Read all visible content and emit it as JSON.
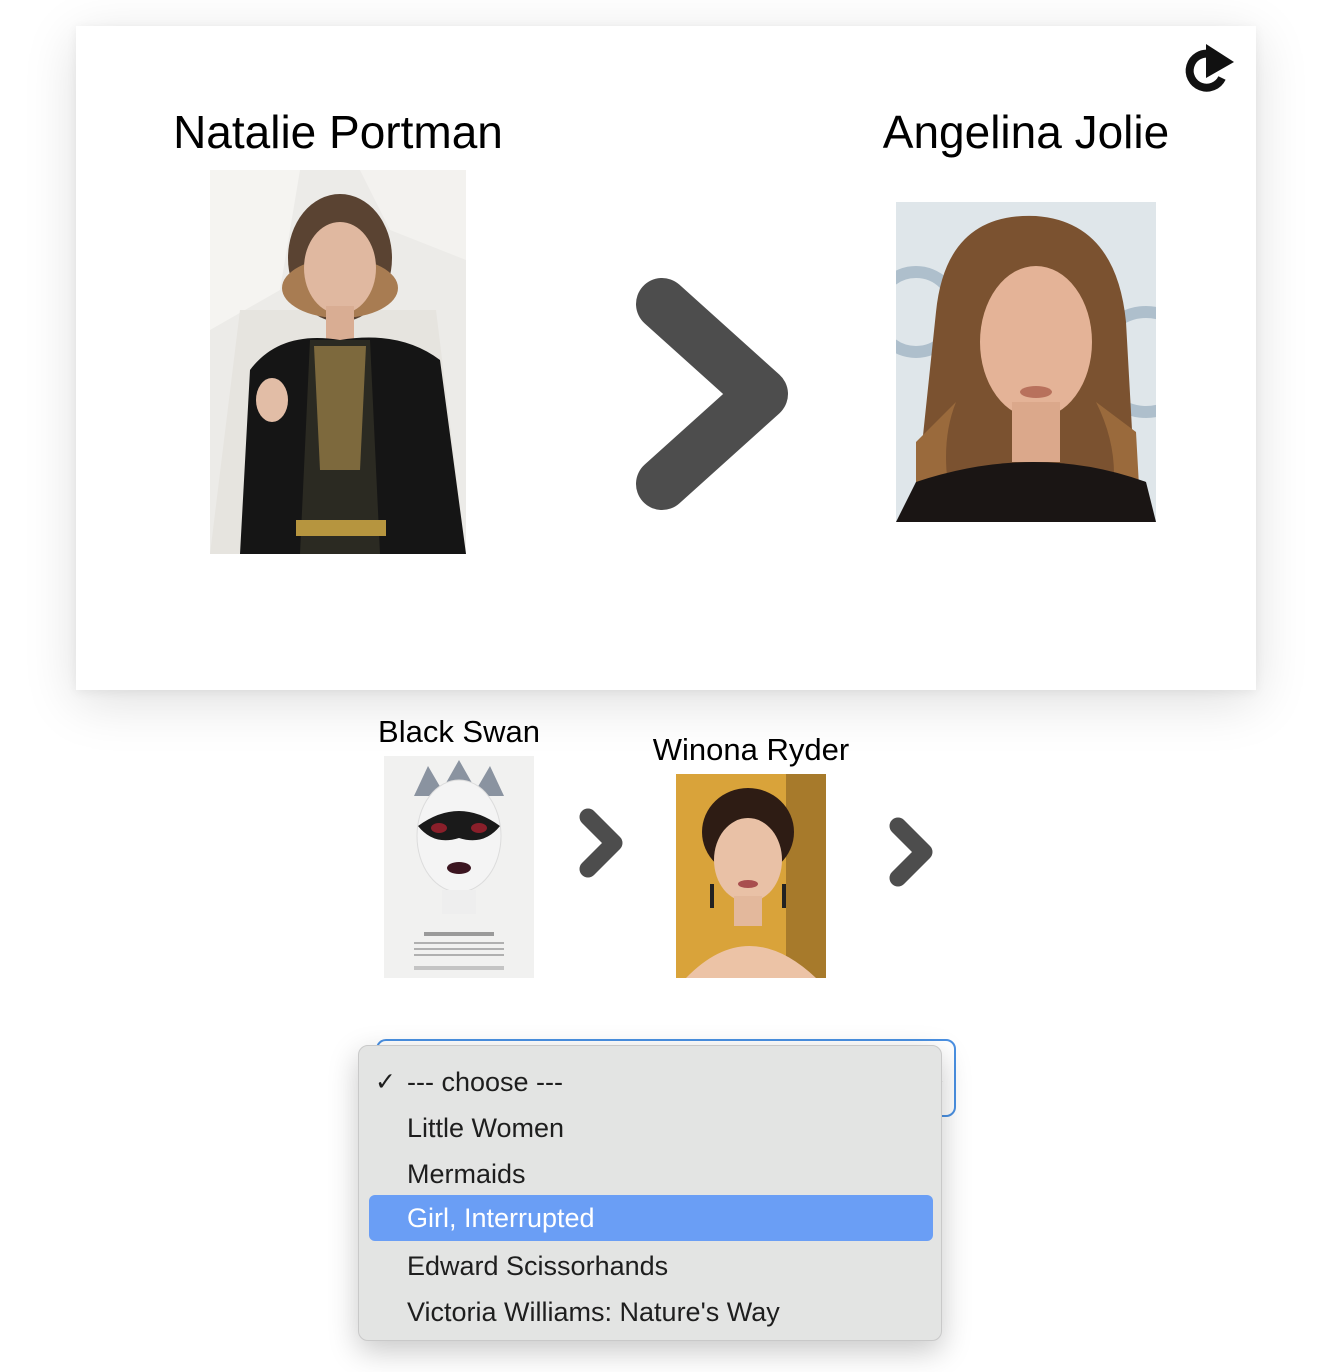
{
  "game": {
    "start_actor": "Natalie Portman",
    "target_actor": "Angelina Jolie",
    "reload_icon": "reload-icon",
    "arrow_icon": "chevron-right-icon"
  },
  "chain": [
    {
      "type": "movie",
      "label": "Black Swan"
    },
    {
      "type": "actor",
      "label": "Winona Ryder"
    }
  ],
  "select": {
    "current_value": "--- choose ---",
    "options": [
      {
        "label": "--- choose ---",
        "checked": true
      },
      {
        "label": "Little Women"
      },
      {
        "label": "Mermaids"
      },
      {
        "label": "Girl, Interrupted",
        "highlighted": true
      },
      {
        "label": "Edward Scissorhands"
      },
      {
        "label": "Victoria Williams: Nature's Way"
      }
    ]
  },
  "colors": {
    "arrow": "#4d4d4d",
    "select_border": "#4a90e2",
    "highlight": "#6a9ef5",
    "dropdown_bg": "#e3e4e3"
  }
}
